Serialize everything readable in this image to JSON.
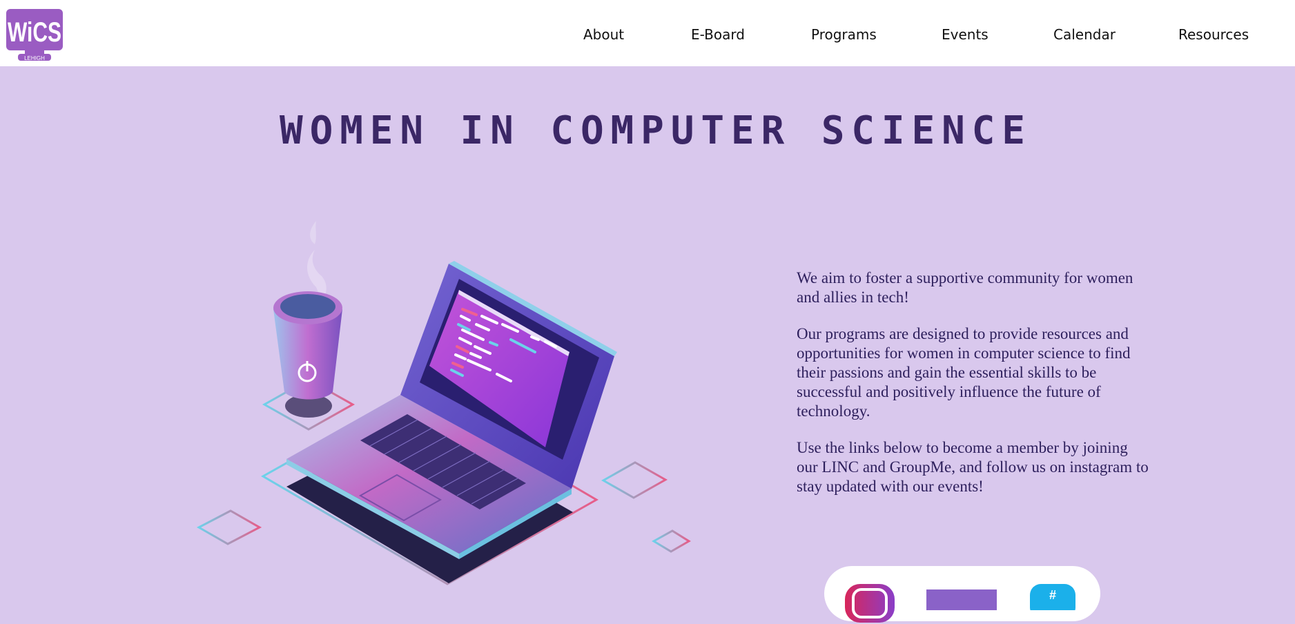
{
  "header": {
    "logo_text": "WiCS",
    "logo_subtext": "LEHIGH",
    "nav": [
      {
        "label": "About"
      },
      {
        "label": "E-Board"
      },
      {
        "label": "Programs"
      },
      {
        "label": "Events"
      },
      {
        "label": "Calendar"
      },
      {
        "label": "Resources"
      }
    ]
  },
  "hero": {
    "title": "WOMEN IN COMPUTER SCIENCE"
  },
  "intro": {
    "paragraphs": [
      "We aim to foster a supportive community for women and allies in tech!",
      "Our programs are designed to provide resources and opportunities for women in computer science to find their passions and gain the essential skills to be successful and positively influence the future of technology.",
      "Use the links below to become a member by joining our LINC and GroupMe, and follow us on instagram to stay updated with our events!"
    ]
  },
  "social": {
    "icons": [
      "instagram-icon",
      "linc-icon",
      "groupme-icon"
    ]
  },
  "colors": {
    "page_bg": "#d9c8ed",
    "title": "#3b2766",
    "body_text": "#2d1f5c",
    "logo": "#9a5cc2",
    "accent_pink": "#e05a8a",
    "accent_cyan": "#5fd0ea"
  }
}
